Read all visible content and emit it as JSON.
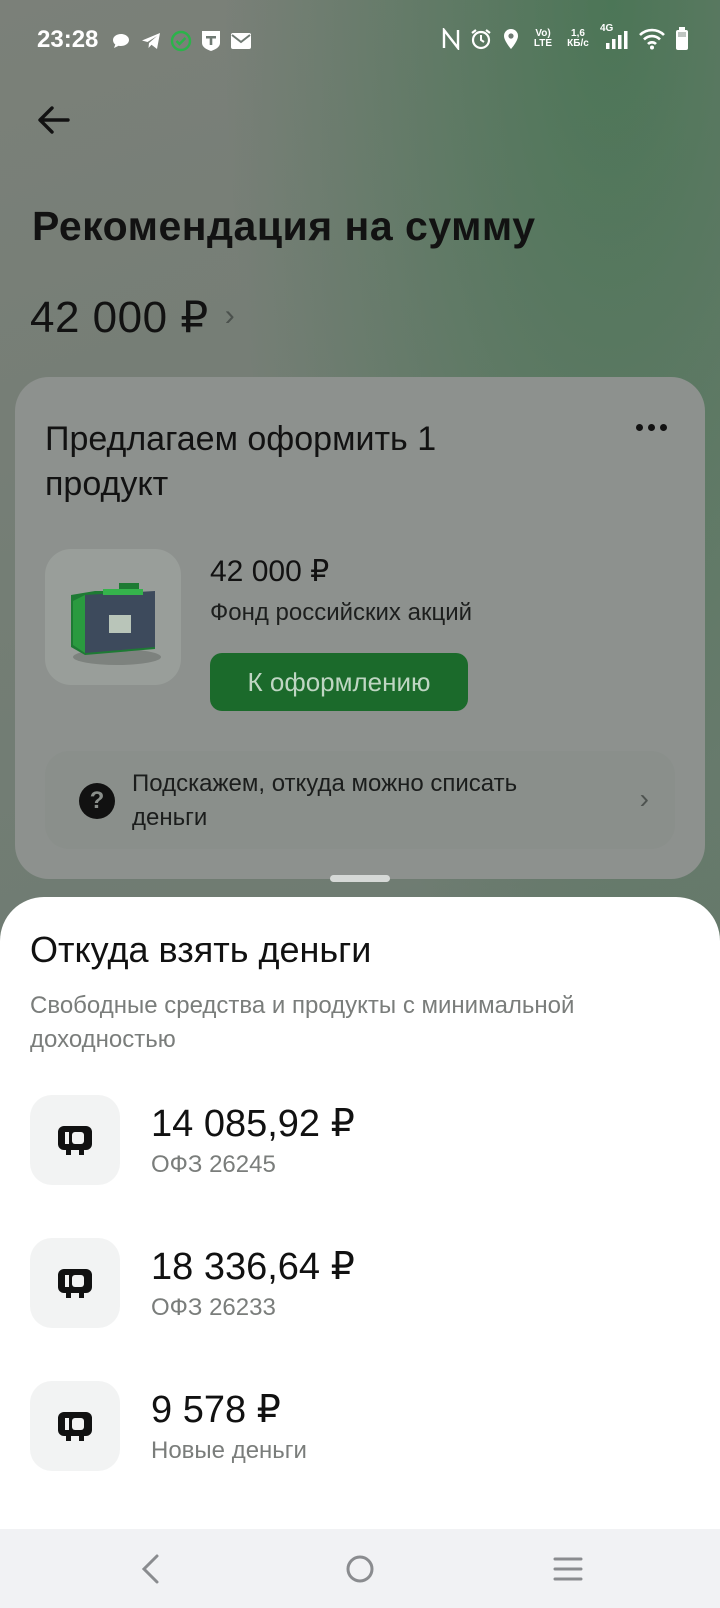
{
  "status_bar": {
    "time": "23:28",
    "left_icons": [
      "chat-bubble-icon",
      "telegram-icon",
      "sber-icon",
      "t-bank-icon",
      "mail-icon"
    ],
    "right_icons": [
      "nfc-icon",
      "alarm-icon",
      "location-icon",
      "volte-icon",
      "speed-icon",
      "4g-signal-icon",
      "wifi-icon",
      "battery-icon"
    ],
    "volte_label_top": "Vo)",
    "volte_label_bottom": "LTE",
    "speed_value": "1,6",
    "speed_unit": "КБ/с",
    "network": "4G"
  },
  "header": {
    "title": "Рекомендация на сумму",
    "amount": "42 000 ₽"
  },
  "offer_card": {
    "title": "Предлагаем оформить 1 продукт",
    "product": {
      "amount": "42 000 ₽",
      "name": "Фонд российских акций",
      "button_label": "К оформлению"
    },
    "hint": {
      "text": "Подскажем, откуда можно списать деньги"
    }
  },
  "sheet": {
    "title": "Откуда взять деньги",
    "subtitle": "Свободные средства и продукты с минимальной доходностью",
    "items": [
      {
        "amount": "14 085,92 ₽",
        "name": "ОФЗ 26245",
        "icon": "wallet-icon"
      },
      {
        "amount": "18 336,64 ₽",
        "name": "ОФЗ 26233",
        "icon": "wallet-icon"
      },
      {
        "amount": "9 578 ₽",
        "name": "Новые деньги",
        "icon": "wallet-icon"
      }
    ]
  },
  "colors": {
    "accent_green": "#1b6a2b",
    "sheet_background": "#ffffff",
    "muted_text": "#7a7d7b"
  }
}
